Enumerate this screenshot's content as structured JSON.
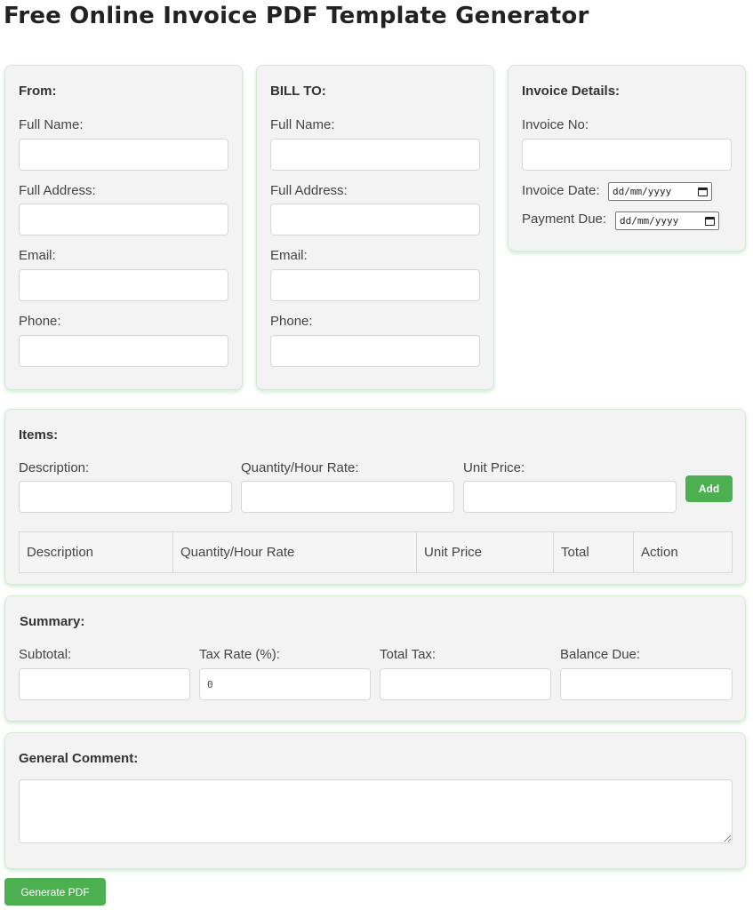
{
  "page_title": "Free Online Invoice PDF Template Generator",
  "from": {
    "heading": "From:",
    "full_name_label": "Full Name:",
    "full_address_label": "Full Address:",
    "email_label": "Email:",
    "phone_label": "Phone:",
    "full_name_value": "",
    "full_address_value": "",
    "email_value": "",
    "phone_value": ""
  },
  "bill_to": {
    "heading": "BILL TO:",
    "full_name_label": "Full Name:",
    "full_address_label": "Full Address:",
    "email_label": "Email:",
    "phone_label": "Phone:",
    "full_name_value": "",
    "full_address_value": "",
    "email_value": "",
    "phone_value": ""
  },
  "invoice_details": {
    "heading": "Invoice Details:",
    "invoice_no_label": "Invoice No:",
    "invoice_no_value": "",
    "invoice_date_label": "Invoice Date:",
    "invoice_date_placeholder": "dd/mm/yyyy",
    "payment_due_label": "Payment Due:",
    "payment_due_placeholder": "dd/mm/yyyy"
  },
  "items": {
    "heading": "Items:",
    "description_label": "Description:",
    "quantity_label": "Quantity/Hour Rate:",
    "unit_price_label": "Unit Price:",
    "add_button": "Add",
    "table_headers": [
      "Description",
      "Quantity/Hour Rate",
      "Unit Price",
      "Total",
      "Action"
    ],
    "rows": []
  },
  "summary": {
    "heading": "Summary:",
    "subtotal_label": "Subtotal:",
    "tax_rate_label": "Tax Rate (%):",
    "tax_rate_value": "0",
    "total_tax_label": "Total Tax:",
    "balance_due_label": "Balance Due:"
  },
  "comment": {
    "heading": "General Comment:",
    "value": ""
  },
  "generate_button": "Generate PDF",
  "colors": {
    "accent_green": "#4caf50",
    "card_bg": "#f3f3f3"
  }
}
